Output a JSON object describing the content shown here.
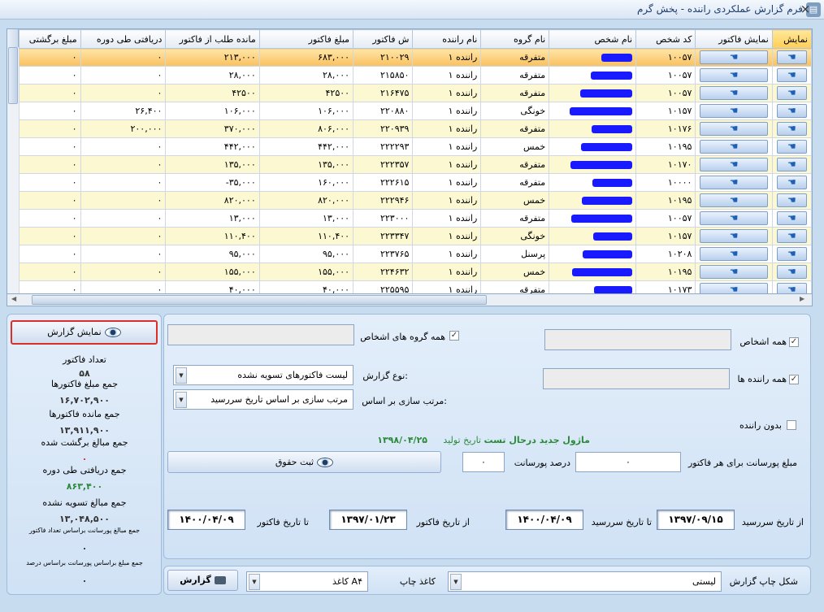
{
  "window": {
    "title": "فرم گزارش عملکردی راننده - پخش گرم",
    "close_glyph": "×",
    "app_icon": "form-icon"
  },
  "grid": {
    "columns": [
      "نمایش",
      "نمایش فاکتور",
      "کد شخص",
      "نام شخص",
      "نام گروه",
      "نام راننده",
      "ش فاکتور",
      "مبلغ فاکتور",
      "مانده طلب از فاکتور",
      "دریافتی طی دوره",
      "مبلغ برگشتی"
    ],
    "row_button_icon": "hand-pointer-icon",
    "rows": [
      {
        "code": "۱۰۰۵۷",
        "group": "متفرقه",
        "driver": "راننده ۱",
        "inv": "۲۱۰۰۲۹",
        "amount": "۶۸۳,۰۰۰",
        "rem": "۲۱۳,۰۰۰",
        "recv": "۰",
        "ret": "۰"
      },
      {
        "code": "۱۰۰۵۷",
        "group": "متفرقه",
        "driver": "راننده ۱",
        "inv": "۲۱۵۸۵۰",
        "amount": "۲۸,۰۰۰",
        "rem": "۲۸,۰۰۰",
        "recv": "۰",
        "ret": "۰"
      },
      {
        "code": "۱۰۰۵۷",
        "group": "متفرقه",
        "driver": "راننده ۱",
        "inv": "۲۱۶۴۷۵",
        "amount": "۴۲۵۰۰",
        "rem": "۴۲۵۰۰",
        "recv": "۰",
        "ret": "۰"
      },
      {
        "code": "۱۰۱۵۷",
        "group": "خونگی",
        "driver": "راننده ۱",
        "inv": "۲۲۰۸۸۰",
        "amount": "۱۰۶,۰۰۰",
        "rem": "۱۰۶,۰۰۰",
        "recv": "۲۶,۴۰۰",
        "ret": "۰"
      },
      {
        "code": "۱۰۱۷۶",
        "group": "متفرقه",
        "driver": "راننده ۱",
        "inv": "۲۲۰۹۳۹",
        "amount": "۸۰۶,۰۰۰",
        "rem": "۳۷۰,۰۰۰",
        "recv": "۲۰۰,۰۰۰",
        "ret": "۰"
      },
      {
        "code": "۱۰۱۹۵",
        "group": "خمس",
        "driver": "راننده ۱",
        "inv": "۲۲۲۲۹۳",
        "amount": "۴۴۲,۰۰۰",
        "rem": "۴۴۲,۰۰۰",
        "recv": "۰",
        "ret": "۰"
      },
      {
        "code": "۱۰۱۷۰",
        "group": "متفرقه",
        "driver": "راننده ۱",
        "inv": "۲۲۲۳۵۷",
        "amount": "۱۳۵,۰۰۰",
        "rem": "۱۳۵,۰۰۰",
        "recv": "۰",
        "ret": "۰"
      },
      {
        "code": "۱۰۰۰۰",
        "group": "متفرقه",
        "driver": "راننده ۱",
        "inv": "۲۲۲۶۱۵",
        "amount": "۱۶۰,۰۰۰",
        "rem": "۳۵,۰۰۰-",
        "recv": "۰",
        "ret": "۰"
      },
      {
        "code": "۱۰۱۹۵",
        "group": "خمس",
        "driver": "راننده ۱",
        "inv": "۲۲۲۹۴۶",
        "amount": "۸۲۰,۰۰۰",
        "rem": "۸۲۰,۰۰۰",
        "recv": "۰",
        "ret": "۰"
      },
      {
        "code": "۱۰۰۵۷",
        "group": "متفرقه",
        "driver": "راننده ۱",
        "inv": "۲۲۳۰۰۰",
        "amount": "۱۳,۰۰۰",
        "rem": "۱۳,۰۰۰",
        "recv": "۰",
        "ret": "۰"
      },
      {
        "code": "۱۰۱۵۷",
        "group": "خونگی",
        "driver": "راننده ۱",
        "inv": "۲۲۳۳۴۷",
        "amount": "۱۱۰,۴۰۰",
        "rem": "۱۱۰,۴۰۰",
        "recv": "۰",
        "ret": "۰"
      },
      {
        "code": "۱۰۲۰۸",
        "group": "پرسنل",
        "driver": "راننده ۱",
        "inv": "۲۲۳۷۶۵",
        "amount": "۹۵,۰۰۰",
        "rem": "۹۵,۰۰۰",
        "recv": "۰",
        "ret": "۰"
      },
      {
        "code": "۱۰۱۹۵",
        "group": "خمس",
        "driver": "راننده ۱",
        "inv": "۲۲۴۶۳۲",
        "amount": "۱۵۵,۰۰۰",
        "rem": "۱۵۵,۰۰۰",
        "recv": "۰",
        "ret": "۰"
      },
      {
        "code": "۱۰۱۷۳",
        "group": "متفرقه",
        "driver": "راننده ۱",
        "inv": "۲۲۵۵۹۵",
        "amount": "۴۰,۰۰۰",
        "rem": "۴۰,۰۰۰",
        "recv": "۰",
        "ret": "۰"
      }
    ]
  },
  "summary": {
    "show_report_label": "نمایش گزارش",
    "items": [
      {
        "label": "تعداد فاکتور",
        "value": "۵۸"
      },
      {
        "label": "جمع مبلغ فاکتورها",
        "value": "۱۶,۷۰۲,۹۰۰"
      },
      {
        "label": "جمع مانده فاکتورها",
        "value": "۱۳,۹۱۱,۹۰۰"
      },
      {
        "label": "جمع مبالغ برگشت شده",
        "value": "۰"
      },
      {
        "label": "جمع دریافتی طی دوره",
        "value": "۸۶۳,۴۰۰"
      },
      {
        "label": "جمع مبالغ تسویه نشده",
        "value": "۱۳,۰۴۸,۵۰۰"
      },
      {
        "label": "جمع مبالغ پورسانت براساس تعداد فاکتور",
        "value": "۰"
      },
      {
        "label": "جمع مبلغ براساس پورسانت براساس درصد",
        "value": "۰"
      }
    ]
  },
  "filters": {
    "all_persons": "همه اشخاص",
    "all_drivers": "همه راننده ها",
    "without_driver": "بدون راننده",
    "all_person_groups": "همه گروه های اشخاص",
    "report_type_label": "نوع گزارش:",
    "report_type_value": "لیست فاکتورهای تسویه نشده",
    "sort_label": "مرتب سازی بر اساس:",
    "sort_value": "مرتب سازی بر اساس تاریخ سررسید",
    "module_note": "ماژول جدید درحال تست",
    "build_label": "تاریخ تولید",
    "build_date": "۱۳۹۸/۰۴/۲۵",
    "commission_per_invoice_label": "مبلغ پورسانت برای هر فاکتور",
    "commission_per_invoice_value": "۰",
    "commission_percent_label": "درصد پورسانت",
    "commission_percent_value": "۰",
    "save_rights_label": "ثبت حقوق",
    "from_due_label": "از تاریخ سررسید",
    "from_due_value": "۱۳۹۷/۰۹/۱۵",
    "to_due_label": "تا تاریخ سررسید",
    "to_due_value": "۱۴۰۰/۰۴/۰۹",
    "from_invoice_label": "از تاریخ فاکتور",
    "from_invoice_value": "۱۳۹۷/۰۱/۲۳",
    "to_invoice_label": "تا تاریخ فاکتور",
    "to_invoice_value": "۱۴۰۰/۰۴/۰۹"
  },
  "print": {
    "shape_label": "شکل چاپ گزارش",
    "shape_value": "لیستی",
    "paper_label": "کاغذ چاپ",
    "paper_value": "کاغذ A۴",
    "report_button": "گزارش"
  },
  "colors": {
    "redacted": "#1a1aff",
    "highlight_border": "#d9302c",
    "build_text": "#2a8a3a",
    "selected_row": "#f9c05f",
    "alt_row": "#fbf8d2"
  }
}
